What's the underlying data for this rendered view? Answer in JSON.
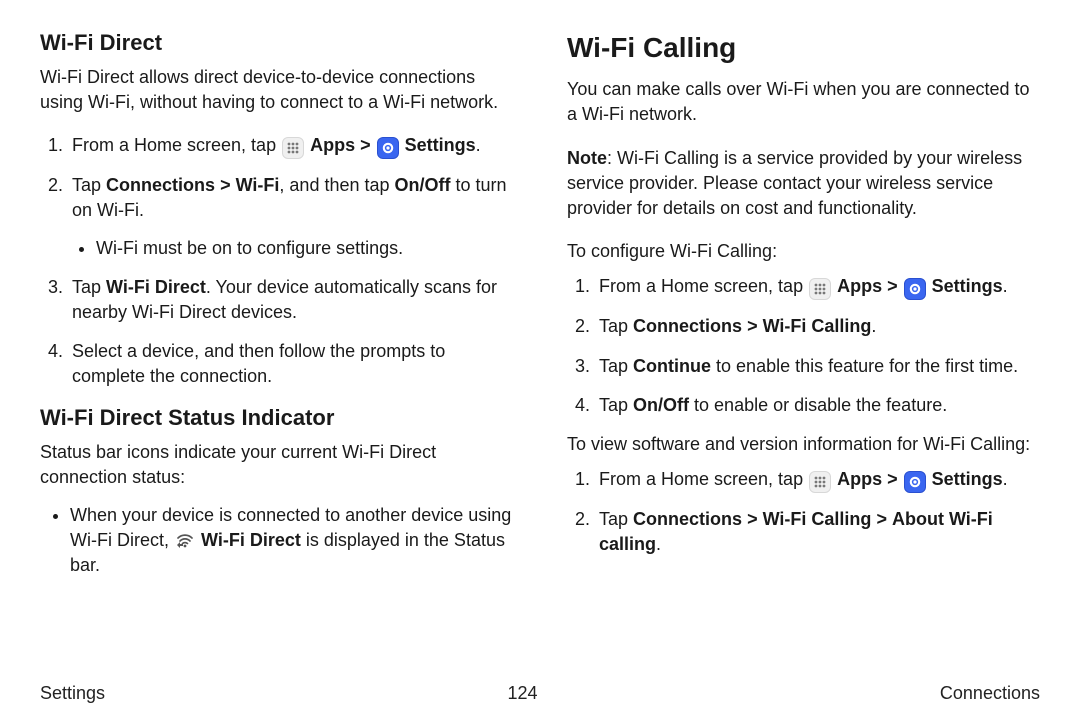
{
  "left": {
    "h_direct": "Wi‑Fi Direct",
    "direct_intro": "Wi‑Fi Direct allows direct device-to-device connections using Wi‑Fi, without having to connect to a Wi‑Fi network.",
    "s1_pre": "From a Home screen, tap ",
    "apps": "Apps",
    "chev": ">",
    "settings": "Settings",
    "dot": ".",
    "s2_a": "Tap ",
    "s2_b": "Connections",
    "s2_c": "Wi‑Fi",
    "s2_d": ", and then tap ",
    "s2_e": "On/Off",
    "s2_f": " to turn on Wi‑Fi.",
    "s2_sub": "Wi‑Fi must be on to configure settings.",
    "s3_a": "Tap ",
    "s3_b": "Wi‑Fi Direct",
    "s3_c": ". Your device automatically scans for nearby Wi‑Fi Direct devices.",
    "s4": "Select a device, and then follow the prompts to complete the connection.",
    "h_status": "Wi‑Fi Direct Status Indicator",
    "status_intro": "Status bar icons indicate your current Wi‑Fi Direct connection status:",
    "status_b1_a": "When your device is connected to another device using Wi‑Fi Direct, ",
    "status_b1_b": "Wi‑Fi Direct",
    "status_b1_c": " is displayed in the Status bar."
  },
  "right": {
    "h_call": "Wi‑Fi Calling",
    "call_intro": "You can make calls over Wi‑Fi when you are connected to a Wi‑Fi network.",
    "note_label": "Note",
    "note_body": ": Wi‑Fi Calling is a service provided by your wireless service provider. Please contact your wireless service provider for details on cost and functionality.",
    "cfg_intro": "To configure Wi‑Fi Calling:",
    "r2_a": "Tap ",
    "r2_b": "Connections",
    "r2_c": "Wi‑Fi Calling",
    "r3_a": "Tap ",
    "r3_b": "Continue",
    "r3_c": " to enable this feature for the first time.",
    "r4_a": "Tap ",
    "r4_b": "On/Off",
    "r4_c": " to enable or disable the feature.",
    "view_intro": "To view software and version information for Wi‑Fi Calling:",
    "v2_a": "Tap ",
    "v2_b": "Connections",
    "v2_c": "Wi‑Fi Calling",
    "v2_d": "About Wi‑Fi calling"
  },
  "footer": {
    "left": "Settings",
    "center": "124",
    "right": "Connections"
  }
}
